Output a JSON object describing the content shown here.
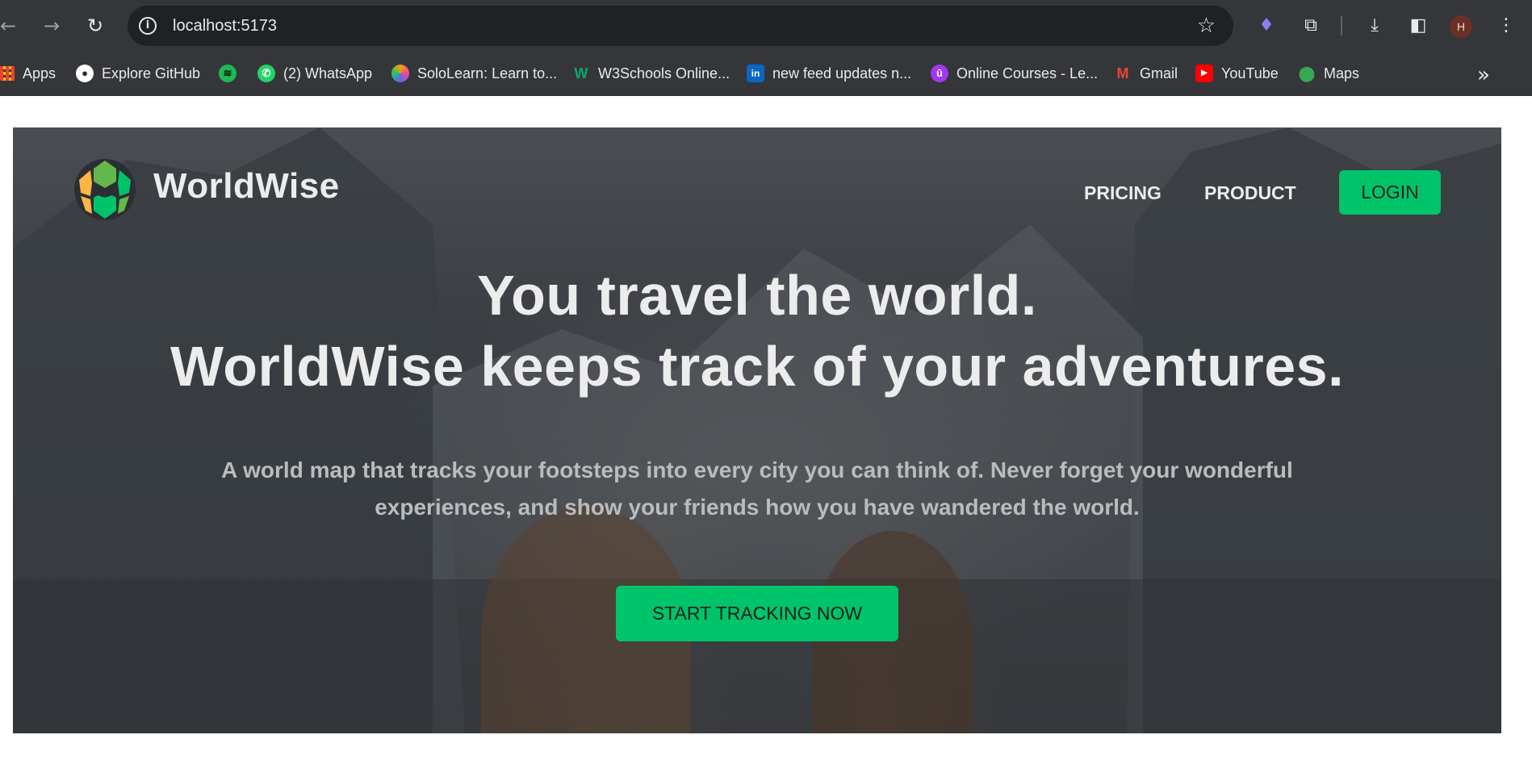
{
  "browser": {
    "url": "localhost:5173",
    "avatar_initial": "H",
    "bookmarks": [
      {
        "label": "Apps",
        "icon": "apps-grid-icon",
        "color": "#ea4335"
      },
      {
        "label": "Explore GitHub",
        "icon": "github-icon",
        "color": "#ffffff"
      },
      {
        "label": "",
        "icon": "spotify-icon",
        "color": "#1db954"
      },
      {
        "label": "(2) WhatsApp",
        "icon": "whatsapp-icon",
        "color": "#25d366"
      },
      {
        "label": "SoloLearn: Learn to...",
        "icon": "sololearn-icon",
        "color": "#f59e0b"
      },
      {
        "label": "W3Schools Online...",
        "icon": "w3schools-icon",
        "color": "#04aa6d"
      },
      {
        "label": "new feed updates n...",
        "icon": "linkedin-icon",
        "color": "#0a66c2"
      },
      {
        "label": "Online Courses - Le...",
        "icon": "udemy-icon",
        "color": "#a435f0"
      },
      {
        "label": "Gmail",
        "icon": "gmail-icon",
        "color": "#ea4335"
      },
      {
        "label": "YouTube",
        "icon": "youtube-icon",
        "color": "#ff0000"
      },
      {
        "label": "Maps",
        "icon": "maps-icon",
        "color": "#34a853"
      }
    ]
  },
  "site": {
    "brand": "WorldWise",
    "nav": {
      "pricing": "PRICING",
      "product": "PRODUCT",
      "login": "LOGIN"
    },
    "headline_line1": "You travel the world.",
    "headline_line2": "WorldWise keeps track of your adventures.",
    "subtext_line1": "A world map that tracks your footsteps into every city you can think of. Never forget your wonderful",
    "subtext_line2": "experiences, and show your friends how you have wandered the world.",
    "cta": "START TRACKING NOW",
    "accent_color": "#00c46a"
  }
}
